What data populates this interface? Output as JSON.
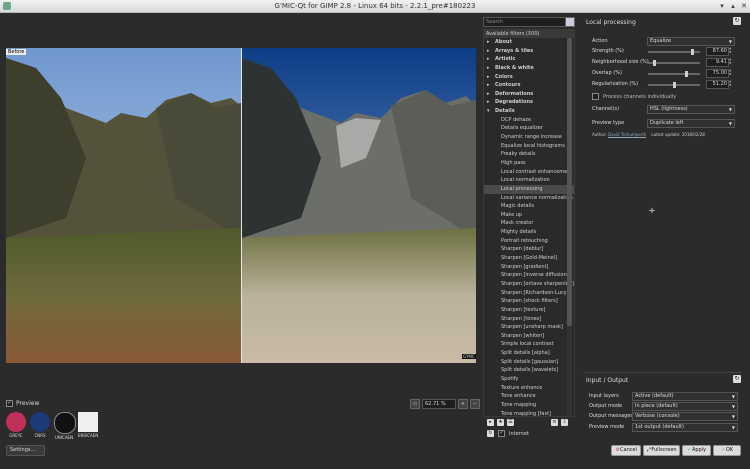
{
  "window": {
    "title": "G'MIC-Qt for GIMP 2.8 - Linux 64 bits - 2.2.1_pre#180223"
  },
  "preview": {
    "before_label": "Before",
    "badge": "G'MIC",
    "checkbox_label": "Preview",
    "zoom_value": "62.71 %"
  },
  "logos": [
    {
      "caption": "GREYC",
      "color": "#c0305a"
    },
    {
      "caption": "CNRS",
      "color": "#1e3a78"
    },
    {
      "caption": "UNICAEN",
      "color": "#111111"
    },
    {
      "caption": "ENSICAEN",
      "color": "#f0f0f0"
    }
  ],
  "settings_button": "Settings...",
  "filters": {
    "search_placeholder": "Search",
    "header": "Available filters (500)",
    "items": [
      {
        "label": "About",
        "type": "cat",
        "open": false
      },
      {
        "label": "Arrays & tiles",
        "type": "cat",
        "open": false
      },
      {
        "label": "Artistic",
        "type": "cat",
        "open": false
      },
      {
        "label": "Black & white",
        "type": "cat",
        "open": false
      },
      {
        "label": "Colors",
        "type": "cat",
        "open": false
      },
      {
        "label": "Contours",
        "type": "cat",
        "open": false
      },
      {
        "label": "Deformations",
        "type": "cat",
        "open": false
      },
      {
        "label": "Degradations",
        "type": "cat",
        "open": false
      },
      {
        "label": "Details",
        "type": "cat",
        "open": true
      },
      {
        "label": "DCP dehaze",
        "type": "child"
      },
      {
        "label": "Details equalizer",
        "type": "child"
      },
      {
        "label": "Dynamic range increase",
        "type": "child"
      },
      {
        "label": "Equalize local histograms",
        "type": "child"
      },
      {
        "label": "Freaky details",
        "type": "child"
      },
      {
        "label": "High pass",
        "type": "child"
      },
      {
        "label": "Local contrast enhancement",
        "type": "child"
      },
      {
        "label": "Local normalization",
        "type": "child"
      },
      {
        "label": "Local processing",
        "type": "child",
        "selected": true
      },
      {
        "label": "Local variance normalization",
        "type": "child"
      },
      {
        "label": "Magic details",
        "type": "child"
      },
      {
        "label": "Make up",
        "type": "child"
      },
      {
        "label": "Mask creator",
        "type": "child"
      },
      {
        "label": "Mighty details",
        "type": "child"
      },
      {
        "label": "Portrait retouching",
        "type": "child"
      },
      {
        "label": "Sharpen [deblur]",
        "type": "child"
      },
      {
        "label": "Sharpen [Gold-Meinel]",
        "type": "child"
      },
      {
        "label": "Sharpen [gradient]",
        "type": "child"
      },
      {
        "label": "Sharpen [inverse diffusion]",
        "type": "child"
      },
      {
        "label": "Sharpen [octave sharpening]",
        "type": "child"
      },
      {
        "label": "Sharpen [Richardson-Lucy]",
        "type": "child"
      },
      {
        "label": "Sharpen [shock filters]",
        "type": "child"
      },
      {
        "label": "Sharpen [texture]",
        "type": "child"
      },
      {
        "label": "Sharpen [tones]",
        "type": "child"
      },
      {
        "label": "Sharpen [unsharp mask]",
        "type": "child"
      },
      {
        "label": "Sharpen [whiten]",
        "type": "child"
      },
      {
        "label": "Simple local contrast",
        "type": "child"
      },
      {
        "label": "Split details [alpha]",
        "type": "child"
      },
      {
        "label": "Split details [gaussian]",
        "type": "child"
      },
      {
        "label": "Split details [wavelets]",
        "type": "child"
      },
      {
        "label": "Spotify",
        "type": "child"
      },
      {
        "label": "Texture enhance",
        "type": "child"
      },
      {
        "label": "Tone enhance",
        "type": "child"
      },
      {
        "label": "Tone mapping",
        "type": "child"
      },
      {
        "label": "Tone mapping [fast]",
        "type": "child"
      }
    ],
    "internet_label": "Internet"
  },
  "params": {
    "title": "Local processing",
    "action": {
      "label": "Action",
      "value": "Equalize"
    },
    "strength": {
      "label": "Strength (%)",
      "value": "87.60",
      "fraction": 0.876
    },
    "neighborhood": {
      "label": "Neighborhood size (%)",
      "value": "9.41",
      "fraction": 0.094
    },
    "overlap": {
      "label": "Overlap (%)",
      "value": "75.00",
      "fraction": 0.75
    },
    "regularization": {
      "label": "Regularization (%)",
      "value": "51.20",
      "fraction": 0.512
    },
    "process_channels": "Process channels individually",
    "channels": {
      "label": "Channel(s)",
      "value": "HSL (lightness)"
    },
    "preview_type": {
      "label": "Preview type",
      "value": "Duplicate left"
    },
    "author_prefix": "Author:",
    "author_name": "David Tschumperlé",
    "latest_update": "Latest update: 2018/02/28"
  },
  "io": {
    "title": "Input / Output",
    "input_layers": {
      "label": "Input layers",
      "value": "Active (default)"
    },
    "output_mode": {
      "label": "Output mode",
      "value": "In place (default)"
    },
    "output_messages": {
      "label": "Output messages",
      "value": "Verbose (console)"
    },
    "preview_mode": {
      "label": "Preview mode",
      "value": "1st output (default)"
    }
  },
  "buttons": {
    "cancel": "Cancel",
    "fullscreen": "Fullscreen",
    "apply": "Apply",
    "ok": "OK"
  }
}
